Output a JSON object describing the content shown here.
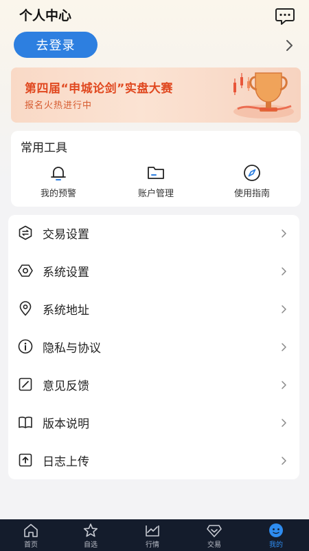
{
  "header": {
    "title": "个人中心",
    "message_icon": "chat-bubble-icon"
  },
  "login": {
    "button_label": "去登录",
    "chevron_icon": "chevron-right-icon"
  },
  "banner": {
    "title": "第四届“申城论剑”实盘大赛",
    "subtitle": "报名火热进行中",
    "art_icon": "trophy-candlestick-icon"
  },
  "tools": {
    "title": "常用工具",
    "items": [
      {
        "label": "我的预警",
        "icon": "bell-icon"
      },
      {
        "label": "账户管理",
        "icon": "folder-icon"
      },
      {
        "label": "使用指南",
        "icon": "compass-icon"
      }
    ]
  },
  "menu": {
    "items": [
      {
        "label": "交易设置",
        "icon": "exchange-hexagon-icon"
      },
      {
        "label": "系统设置",
        "icon": "settings-hexagon-icon"
      },
      {
        "label": "系统地址",
        "icon": "location-pin-icon"
      },
      {
        "label": "隐私与协议",
        "icon": "info-circle-icon"
      },
      {
        "label": "意见反馈",
        "icon": "edit-square-icon"
      },
      {
        "label": "版本说明",
        "icon": "book-icon"
      },
      {
        "label": "日志上传",
        "icon": "upload-icon"
      }
    ]
  },
  "tabbar": {
    "items": [
      {
        "label": "首页",
        "icon": "home-icon",
        "active": false
      },
      {
        "label": "自选",
        "icon": "star-icon",
        "active": false
      },
      {
        "label": "行情",
        "icon": "market-chart-icon",
        "active": false
      },
      {
        "label": "交易",
        "icon": "trade-diamond-icon",
        "active": false
      },
      {
        "label": "我的",
        "icon": "profile-icon",
        "active": true
      }
    ]
  },
  "colors": {
    "accent": "#2d7fe0",
    "banner_text": "#e0481f",
    "tabbar_bg": "#141c2c",
    "tab_active": "#2e8cf0"
  }
}
